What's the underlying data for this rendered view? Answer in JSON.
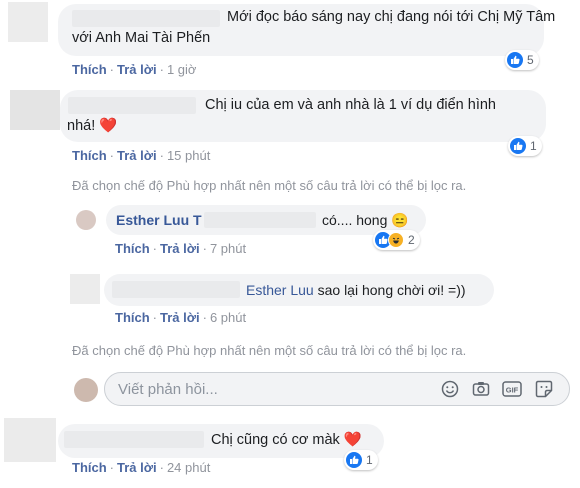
{
  "comments": [
    {
      "text_line1": "Mới đọc báo sáng nay chị đang nói tới Chị Mỹ Tâm",
      "text_line2": "với Anh Mai Tài Phến",
      "like": "Thích",
      "reply": "Trả lời",
      "time": "1 giờ",
      "reaction_count": "5"
    },
    {
      "text_line1": "Chị iu của em và anh nhà là 1 ví dụ điển hình",
      "text_line2": "nhá! ❤️",
      "like": "Thích",
      "reply": "Trả lời",
      "time": "15 phút",
      "reaction_count": "1"
    },
    {
      "text": "Chị cũng có cơ màk ❤️",
      "like": "Thích",
      "reply": "Trả lời",
      "time": "24 phút",
      "reaction_count": "1"
    }
  ],
  "filter_notice": "Đã chọn chế độ Phù hợp nhất nên một số câu trả lời có thể bị lọc ra.",
  "replies": [
    {
      "author": "Esther Luu",
      "author_suffix": "T",
      "text": "có.... hong 😑",
      "like": "Thích",
      "reply": "Trả lời",
      "time": "7 phút",
      "reaction_count": "2"
    },
    {
      "mention": "Esther Luu",
      "text": "sao lại hong chời ơi! =))",
      "like": "Thích",
      "reply": "Trả lời",
      "time": "6 phút"
    }
  ],
  "reply_input": {
    "placeholder": "Viết phản hồi..."
  },
  "colors": {
    "link": "#385898",
    "bubble": "#f2f3f5",
    "like_blue": "#1877f2",
    "heart": "#f33e58"
  },
  "icons": [
    "like-icon",
    "haha-icon",
    "emoji-icon",
    "camera-icon",
    "gif-icon",
    "sticker-icon"
  ]
}
